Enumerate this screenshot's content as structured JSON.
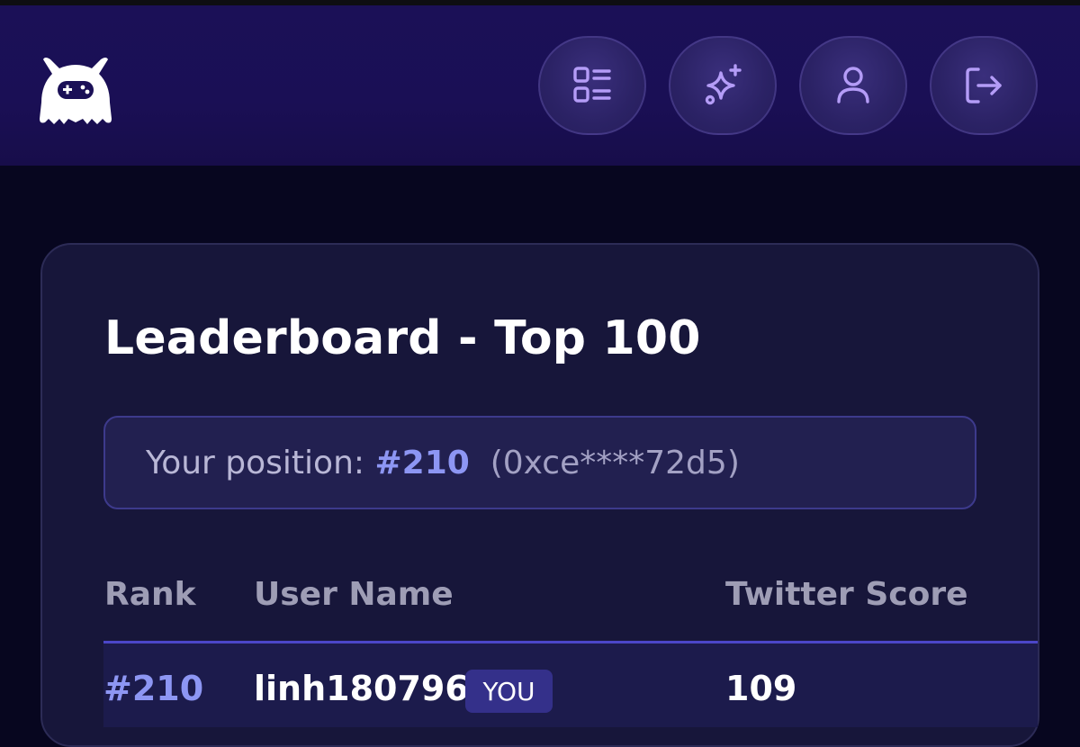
{
  "header": {
    "logo_icon": "gamepad-mascot-icon",
    "nav": [
      {
        "name": "dashboard",
        "icon": "list-grid-icon"
      },
      {
        "name": "features",
        "icon": "sparkles-icon"
      },
      {
        "name": "profile",
        "icon": "user-icon"
      },
      {
        "name": "logout",
        "icon": "logout-icon"
      }
    ]
  },
  "leaderboard": {
    "title": "Leaderboard - Top 100",
    "position": {
      "label": "Your position:",
      "rank": "#210",
      "address": "(0xce****72d5)"
    },
    "columns": [
      "Rank",
      "User Name",
      "Twitter Score"
    ],
    "rows": [
      {
        "rank": "#210",
        "user": "linh180796",
        "badge": "YOU",
        "score": "109"
      }
    ]
  },
  "colors": {
    "accent": "#8d96f3",
    "background": "#07061f",
    "header": "#1b1057",
    "card": "#17163a",
    "icon": "#b49cf7"
  }
}
